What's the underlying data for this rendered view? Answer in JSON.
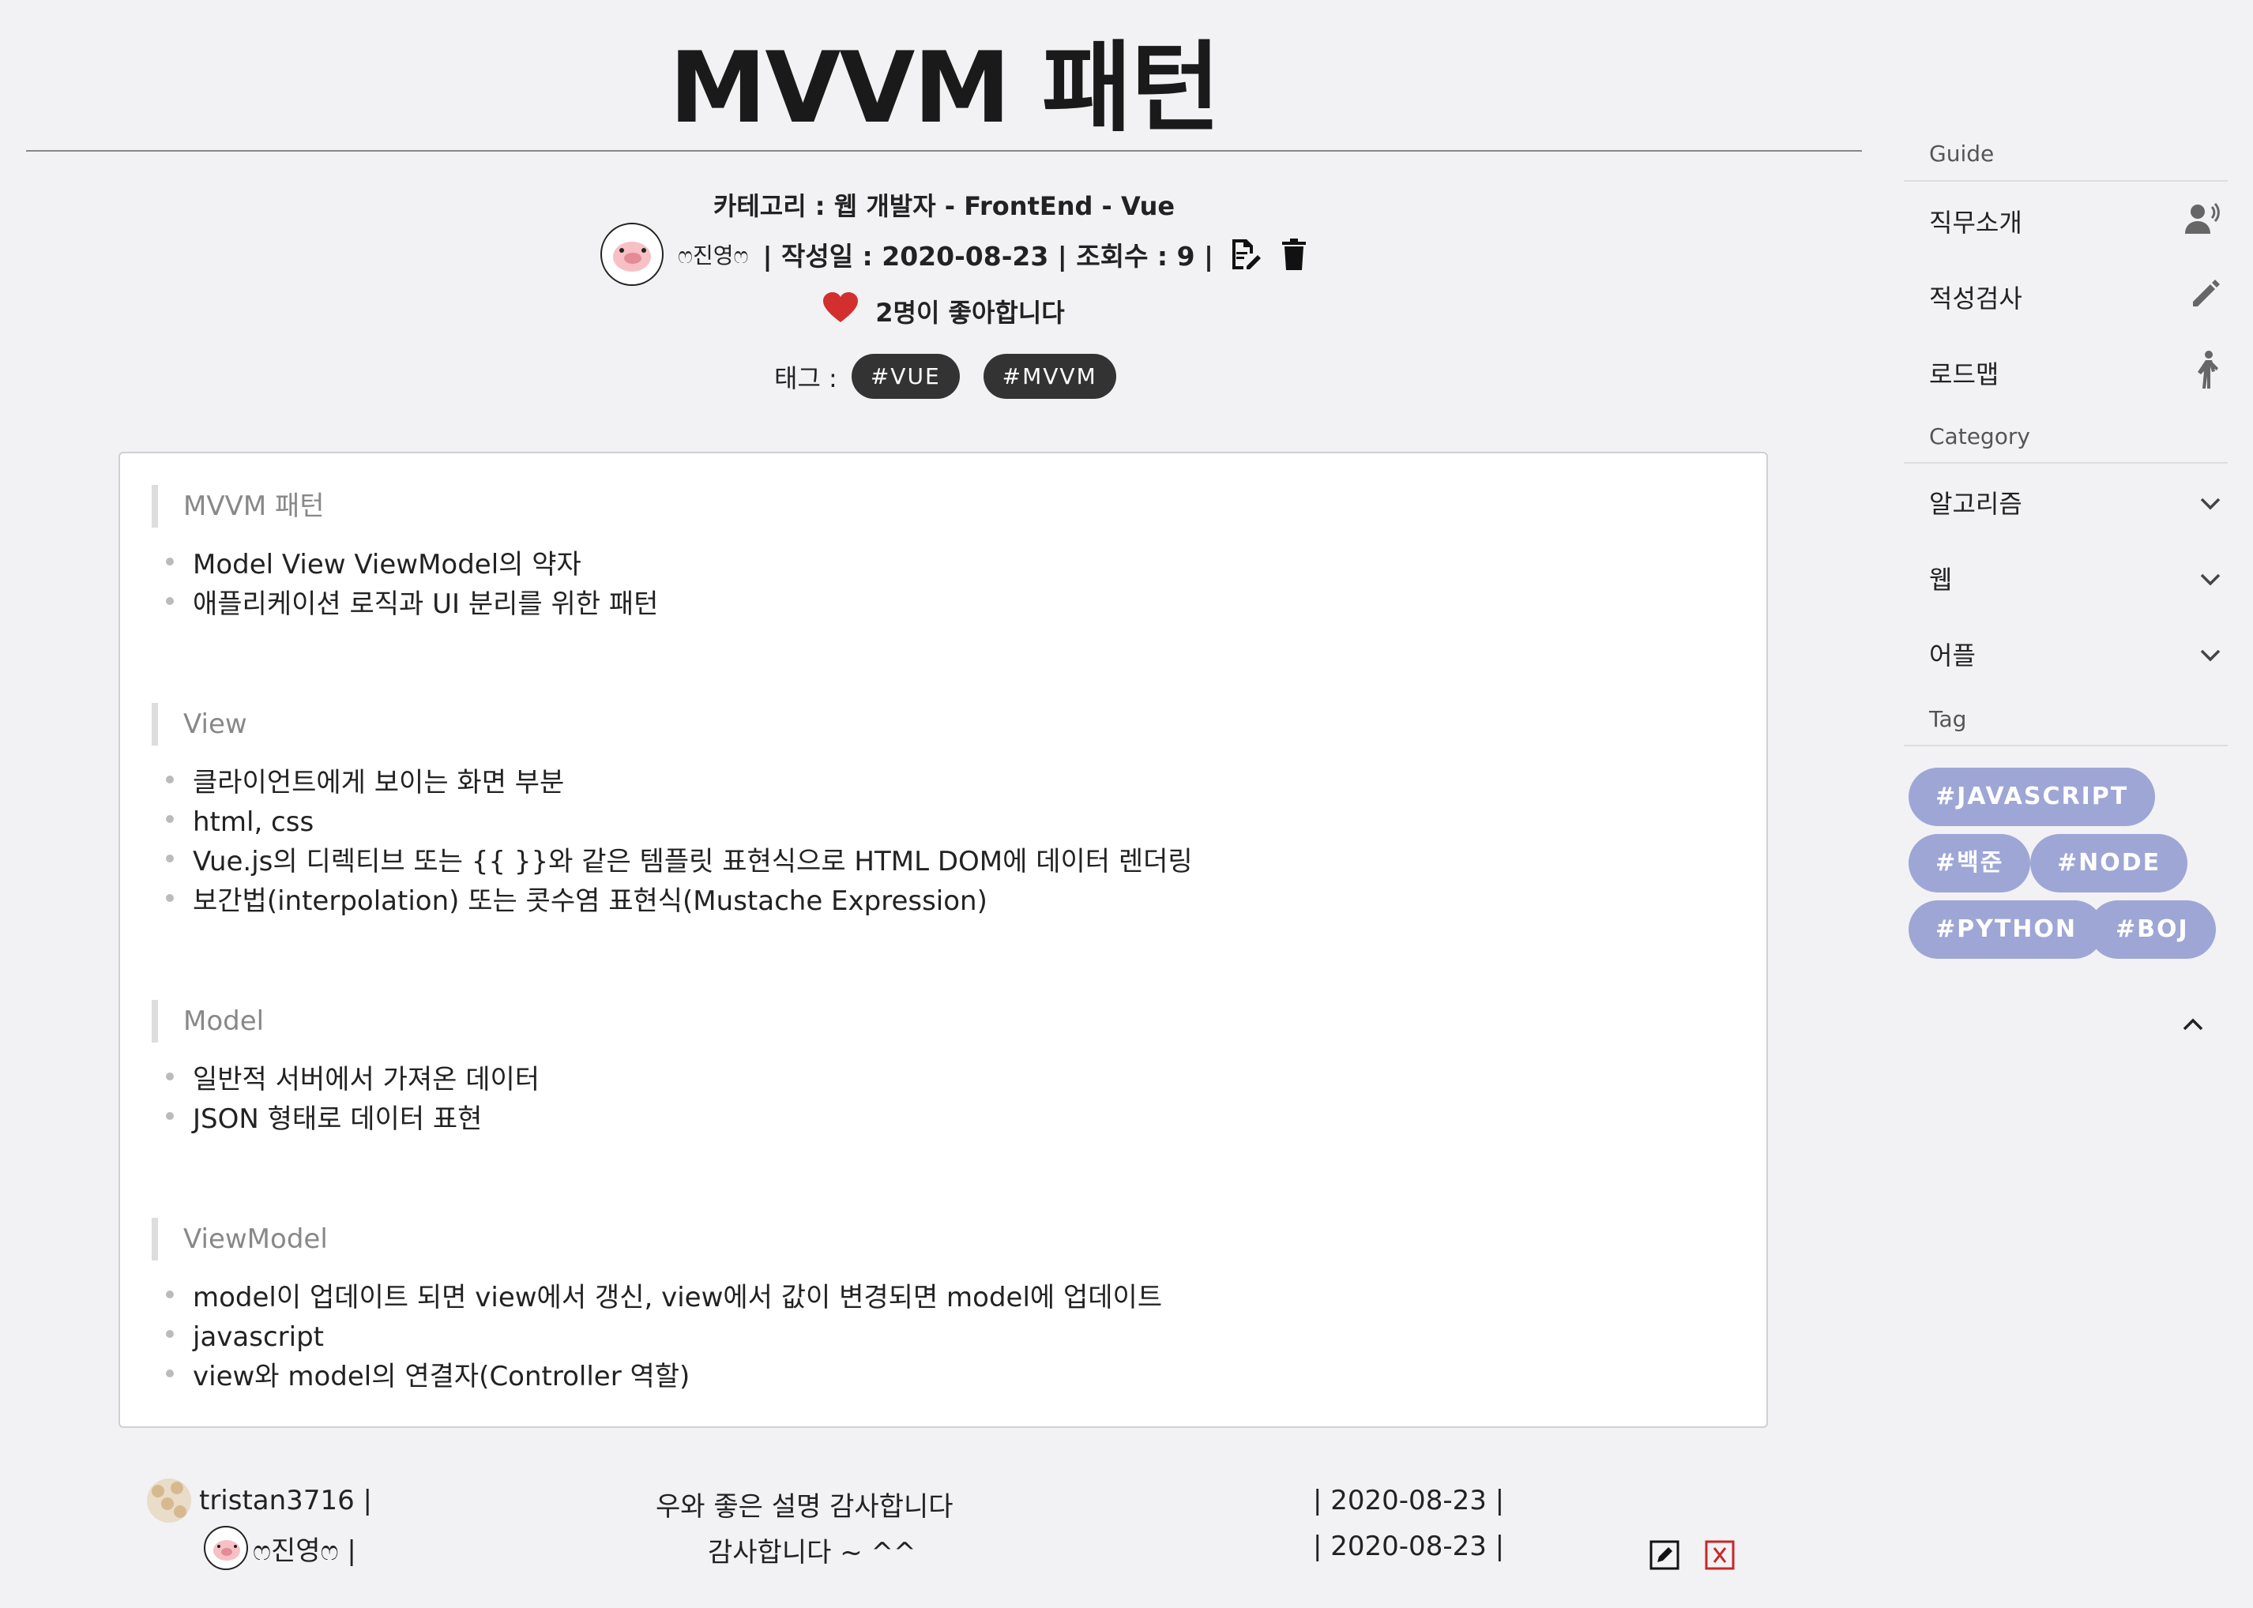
{
  "post": {
    "title": "MVVM 패턴",
    "category_line": "카테고리 : 웹 개발자 - FrontEnd - Vue",
    "author": "ෆ진영ෆ",
    "meta": "| 작성일 : 2020-08-23 | 조회수 : 9 |",
    "likes": "2명이 좋아합니다",
    "tags_label": "태그 :",
    "tags": [
      "#VUE",
      "#MVVM"
    ]
  },
  "content": {
    "sections": [
      {
        "heading": "MVVM 패턴",
        "bullets": [
          "Model View ViewModel의 약자",
          "애플리케이션 로직과 UI 분리를 위한 패턴"
        ]
      },
      {
        "heading": "View",
        "bullets": [
          "클라이언트에게 보이는 화면 부분",
          "html, css",
          "Vue.js의 디렉티브 또는 {{ }}와 같은 템플릿 표현식으로 HTML DOM에 데이터 렌더링",
          "보간법(interpolation) 또는 콧수염 표현식(Mustache Expression)"
        ]
      },
      {
        "heading": "Model",
        "bullets": [
          "일반적 서버에서 가져온 데이터",
          "JSON 형태로 데이터 표현"
        ]
      },
      {
        "heading": "ViewModel",
        "bullets": [
          "model이 업데이트 되면 view에서 갱신, view에서 값이 변경되면 model에 업데이트",
          "javascript",
          "view와 model의 연결자(Controller 역할)"
        ]
      }
    ]
  },
  "comments": [
    {
      "author": "tristan3716 |",
      "text": "우와 좋은 설명 감사합니다",
      "date": "| 2020-08-23 |"
    },
    {
      "author": "ෆ진영ෆ |",
      "text": "감사합니다 ~ ^^",
      "date": "| 2020-08-23 |"
    }
  ],
  "sidebar": {
    "guide_label": "Guide",
    "guide_items": [
      {
        "label": "직무소개",
        "icon": "person-voice-icon"
      },
      {
        "label": "적성검사",
        "icon": "pencil-icon"
      },
      {
        "label": "로드맵",
        "icon": "walking-person-icon"
      }
    ],
    "category_label": "Category",
    "category_items": [
      "알고리즘",
      "웹",
      "어플"
    ],
    "tag_label": "Tag",
    "tags": [
      "#JAVASCRIPT",
      "#백준",
      "#NODE",
      "#PYTHON",
      "#BOJ"
    ]
  },
  "colors": {
    "heart": "#d32f2f",
    "sidebar_tag_bg": "#9ea6d6",
    "post_tag_bg": "#333333",
    "delete_icon": "#c62828"
  }
}
